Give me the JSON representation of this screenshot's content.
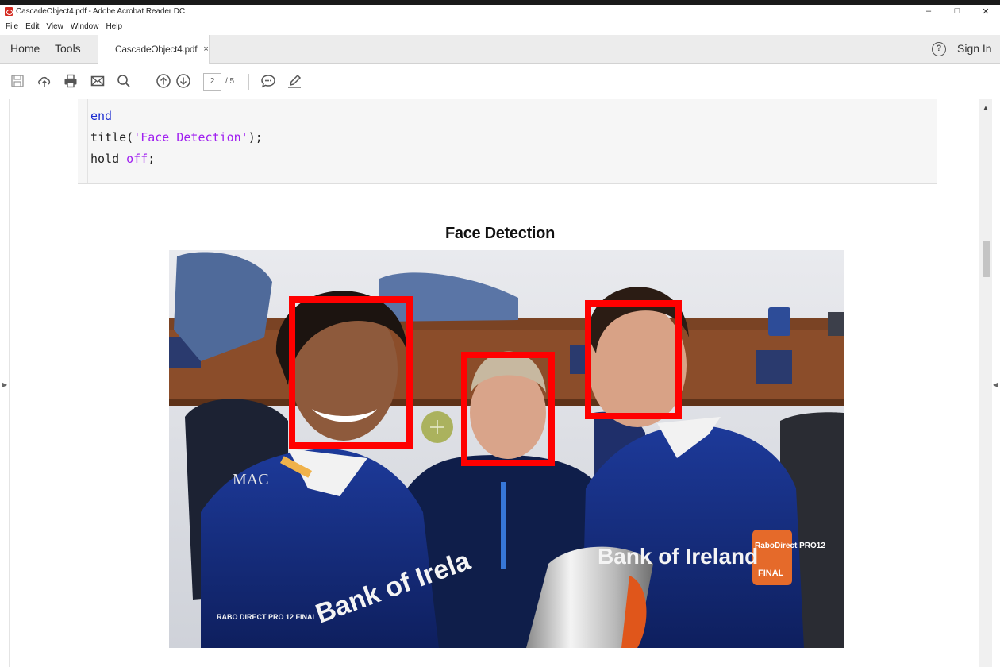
{
  "window": {
    "title": "CascadeObject4.pdf - Adobe Acrobat Reader DC",
    "controls": [
      "–",
      "□",
      "✕"
    ]
  },
  "menu": [
    "File",
    "Edit",
    "View",
    "Window",
    "Help"
  ],
  "tabs": {
    "home": "Home",
    "tools": "Tools",
    "document": "CascadeObject4.pdf",
    "close": "×",
    "help": "?",
    "sign_in": "Sign In"
  },
  "toolbar": {
    "icons": [
      "save-icon",
      "upload-cloud-icon",
      "print-icon",
      "email-icon",
      "search-icon",
      "page-up-icon",
      "page-down-icon",
      "comment-icon",
      "pen-icon"
    ],
    "page_current": "2",
    "page_total": "/ 5"
  },
  "code": {
    "line1_kw": "end",
    "line2_fn": "title(",
    "line2_str": "'Face Detection'",
    "line2_end": ");",
    "line3_fn": "hold ",
    "line3_kw": "off",
    "line3_end": ";",
    "keyword_color": "#1a2bd0",
    "string_color": "#a020f0"
  },
  "figure": {
    "title": "Face Detection",
    "box_color": "#ff0000",
    "detections": 3,
    "jersey_texts": [
      "Bank of Irela",
      "Bank of Ireland",
      "RaboDirect PRO12",
      "FINAL",
      "MAC",
      "RABO DIRECT PRO 12 FINAL"
    ]
  }
}
